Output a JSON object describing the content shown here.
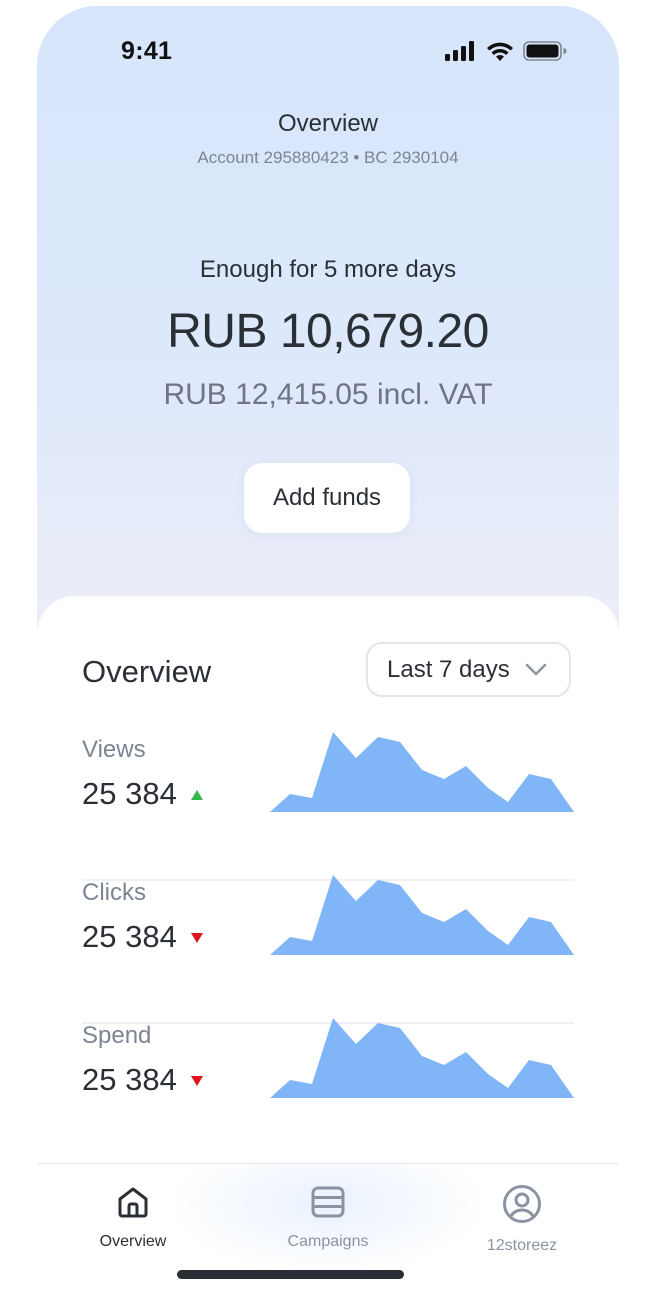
{
  "status_bar": {
    "time": "9:41"
  },
  "header": {
    "title": "Overview",
    "subtitle": "Account 295880423 • BC 2930104"
  },
  "balance": {
    "note": "Enough for 5 more days",
    "amount": "RUB 10,679.20",
    "amount_vat": "RUB 12,415.05 incl. VAT",
    "add_funds_label": "Add funds"
  },
  "overview": {
    "title": "Overview",
    "period": "Last 7 days",
    "metrics": [
      {
        "label": "Views",
        "value": "25 384",
        "trend": "up"
      },
      {
        "label": "Clicks",
        "value": "25 384",
        "trend": "down"
      },
      {
        "label": "Spend",
        "value": "25 384",
        "trend": "down"
      }
    ]
  },
  "tabbar": {
    "items": [
      {
        "label": "Overview",
        "icon": "home-icon",
        "active": true
      },
      {
        "label": "Campaigns",
        "icon": "campaigns-icon",
        "active": false
      },
      {
        "label": "12storeez",
        "icon": "profile-icon",
        "active": false
      }
    ]
  },
  "colors": {
    "accent_chart": "#80b5f7",
    "trend_up": "#3ab54a",
    "trend_down": "#e0141e",
    "text_primary": "#2b2f36",
    "text_secondary": "#7c8594"
  }
}
